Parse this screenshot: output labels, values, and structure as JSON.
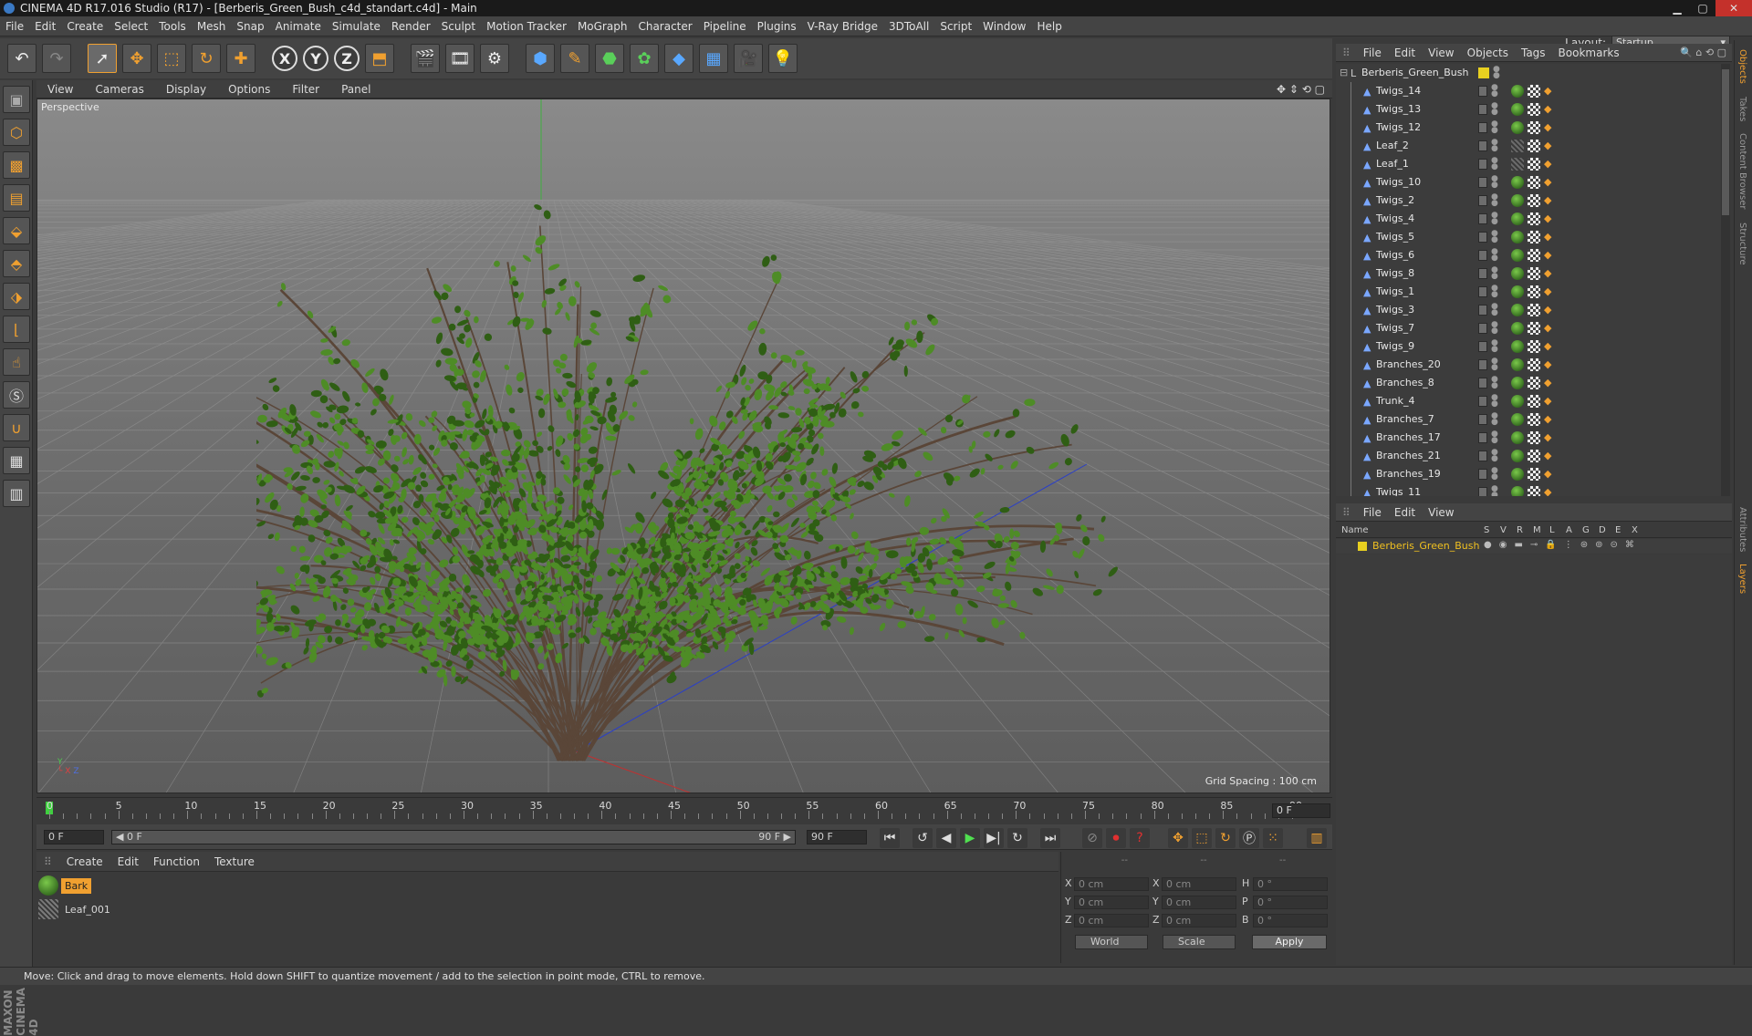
{
  "window": {
    "title": "CINEMA 4D R17.016 Studio (R17) - [Berberis_Green_Bush_c4d_standart.c4d] - Main",
    "min": "▁",
    "max": "▢",
    "close": "✕"
  },
  "menu": [
    "File",
    "Edit",
    "Create",
    "Select",
    "Tools",
    "Mesh",
    "Snap",
    "Animate",
    "Simulate",
    "Render",
    "Sculpt",
    "Motion Tracker",
    "MoGraph",
    "Character",
    "Pipeline",
    "Plugins",
    "V-Ray Bridge",
    "3DToAll",
    "Script",
    "Window",
    "Help"
  ],
  "layout": {
    "label": "Layout:",
    "value": "Startup"
  },
  "viewport": {
    "menu": [
      "View",
      "Cameras",
      "Display",
      "Options",
      "Filter",
      "Panel"
    ],
    "label": "Perspective",
    "grid_spacing": "Grid Spacing : 100 cm",
    "colors": {
      "leaf": "#4e8c26",
      "leaf_dark": "#2f5e14",
      "trunk": "#5a4638"
    }
  },
  "timeline": {
    "ticks": [
      "0",
      "5",
      "10",
      "15",
      "20",
      "25",
      "30",
      "35",
      "40",
      "45",
      "50",
      "55",
      "60",
      "65",
      "70",
      "75",
      "80",
      "85",
      "90"
    ],
    "current_frame": "0 F"
  },
  "playback": {
    "start": "0 F",
    "range_start": "◀ 0 F",
    "range_end": "90 F ▶",
    "end": "90 F"
  },
  "materials": {
    "menu": [
      "Create",
      "Edit",
      "Function",
      "Texture"
    ],
    "items": [
      {
        "name": "Bark",
        "selected": true
      },
      {
        "name": "Leaf_001",
        "selected": false
      }
    ]
  },
  "coords": {
    "header": [
      "--",
      "--",
      "--"
    ],
    "rows": [
      {
        "a1": "X",
        "v1": "0 cm",
        "a2": "X",
        "v2": "0 cm",
        "a3": "H",
        "v3": "0 °"
      },
      {
        "a1": "Y",
        "v1": "0 cm",
        "a2": "Y",
        "v2": "0 cm",
        "a3": "P",
        "v3": "0 °"
      },
      {
        "a1": "Z",
        "v1": "0 cm",
        "a2": "Z",
        "v2": "0 cm",
        "a3": "B",
        "v3": "0 °"
      }
    ],
    "world": "World",
    "scale": "Scale",
    "apply": "Apply"
  },
  "status": "Move: Click and drag to move elements. Hold down SHIFT to quantize movement / add to the selection in point mode, CTRL to remove.",
  "objects": {
    "menu": [
      "File",
      "Edit",
      "View",
      "Objects",
      "Tags",
      "Bookmarks"
    ],
    "root": "Berberis_Green_Bush",
    "items": [
      {
        "name": "Twigs_14",
        "leaf": false
      },
      {
        "name": "Twigs_13",
        "leaf": false
      },
      {
        "name": "Twigs_12",
        "leaf": false
      },
      {
        "name": "Leaf_2",
        "leaf": true
      },
      {
        "name": "Leaf_1",
        "leaf": true
      },
      {
        "name": "Twigs_10",
        "leaf": false
      },
      {
        "name": "Twigs_2",
        "leaf": false
      },
      {
        "name": "Twigs_4",
        "leaf": false
      },
      {
        "name": "Twigs_5",
        "leaf": false
      },
      {
        "name": "Twigs_6",
        "leaf": false
      },
      {
        "name": "Twigs_8",
        "leaf": false
      },
      {
        "name": "Twigs_1",
        "leaf": false
      },
      {
        "name": "Twigs_3",
        "leaf": false
      },
      {
        "name": "Twigs_7",
        "leaf": false
      },
      {
        "name": "Twigs_9",
        "leaf": false
      },
      {
        "name": "Branches_20",
        "leaf": false
      },
      {
        "name": "Branches_8",
        "leaf": false
      },
      {
        "name": "Trunk_4",
        "leaf": false
      },
      {
        "name": "Branches_7",
        "leaf": false
      },
      {
        "name": "Branches_17",
        "leaf": false
      },
      {
        "name": "Branches_21",
        "leaf": false
      },
      {
        "name": "Branches_19",
        "leaf": false
      },
      {
        "name": "Twigs_11",
        "leaf": false
      }
    ]
  },
  "layers": {
    "menu": [
      "File",
      "Edit",
      "View"
    ],
    "columns": [
      "Name",
      "S",
      "V",
      "R",
      "M",
      "L",
      "A",
      "G",
      "D",
      "E",
      "X"
    ],
    "items": [
      {
        "name": "Berberis_Green_Bush",
        "color": "#e8d020"
      }
    ]
  },
  "right_tabs": [
    "Objects",
    "Takes",
    "Content Browser",
    "Structure",
    "Attributes",
    "Layers"
  ],
  "branding": "MAXON CINEMA 4D"
}
